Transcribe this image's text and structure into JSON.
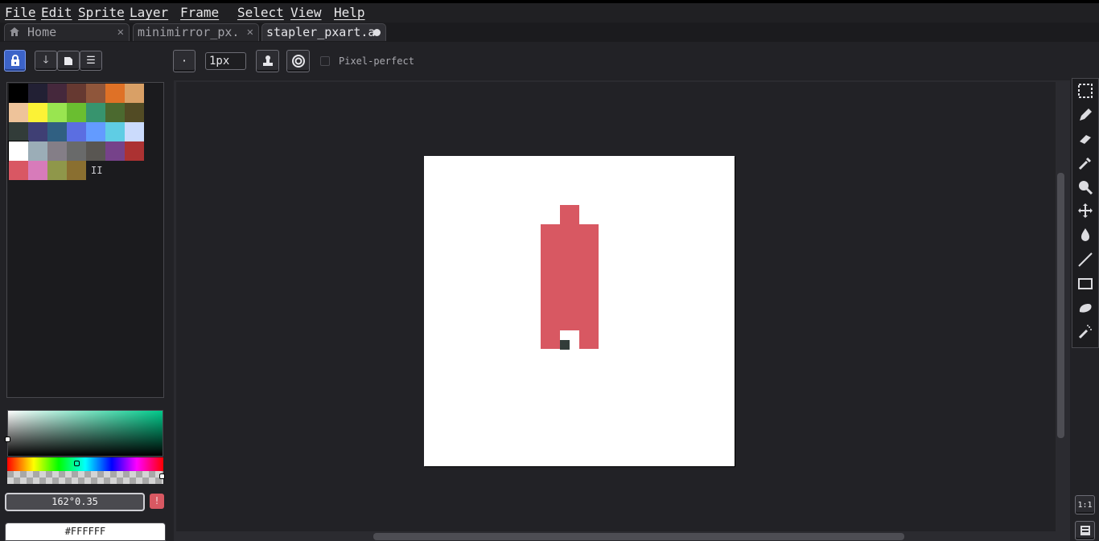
{
  "menu": [
    "File",
    "Edit",
    "Sprite",
    "Layer",
    "Frame",
    "Select",
    "View",
    "Help"
  ],
  "tabs": [
    {
      "label": "Home",
      "closable": true
    },
    {
      "label": "minimirror_px.",
      "closable": true
    },
    {
      "label": "stapler_pxart.a",
      "modified": true
    }
  ],
  "toolbar_top": {
    "brush_type": "·",
    "brush_size": "1px",
    "pixel_perfect_label": "Pixel-perfect",
    "pixel_perfect_checked": false
  },
  "palette": {
    "colors": [
      "#000000",
      "#222034",
      "#45283c",
      "#663931",
      "#8f563b",
      "#df7126",
      "#d9a066",
      "#eec39a",
      "#fbf236",
      "#99e550",
      "#6abe30",
      "#37946e",
      "#4b692f",
      "#524b24",
      "#323c39",
      "#3f3f74",
      "#306082",
      "#5b6ee1",
      "#639bff",
      "#5fcde4",
      "#cbdbfc",
      "#ffffff",
      "#9badb7",
      "#847e87",
      "#696a6a",
      "#595652",
      "#76428a",
      "#ac3232",
      "#d95763",
      "#d77bba",
      "#8f974a",
      "#8a6f30"
    ],
    "more_label": "II"
  },
  "color_picker": {
    "hsv_value": "162°0.35",
    "hex_value": "#FFFFFF",
    "warn_label": "!"
  },
  "tools": [
    "marquee-icon",
    "pencil-icon",
    "eraser-icon",
    "eyedropper-icon",
    "zoom-icon",
    "move-icon",
    "fill-icon",
    "line-icon",
    "rectangle-icon",
    "lasso-icon",
    "spray-icon"
  ],
  "bottom_tools": [
    "1:1"
  ],
  "sprite": {
    "canvas_color": "#ffffff",
    "ink_color": "#d95763",
    "dark_color": "#323c39"
  }
}
